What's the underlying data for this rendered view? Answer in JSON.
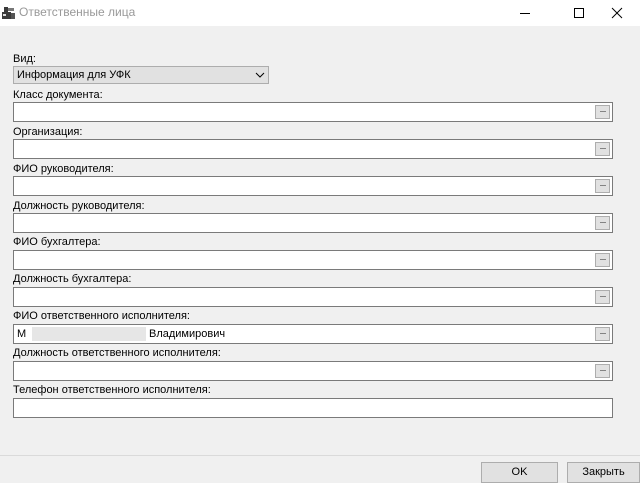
{
  "window": {
    "title": "Ответственные лица",
    "icon": "app-icon"
  },
  "fields": {
    "vid": {
      "label": "Вид:",
      "value": "Информация для УФК"
    },
    "klass_dokumenta": {
      "label": "Класс документа:",
      "value": ""
    },
    "organizaciya": {
      "label": "Организация:",
      "value": ""
    },
    "fio_rukovoditelya": {
      "label": "ФИО руководителя:",
      "value": ""
    },
    "dolzhnost_rukovoditelya": {
      "label": "Должность руководителя:",
      "value": ""
    },
    "fio_buhgaltera": {
      "label": "ФИО бухгалтера:",
      "value": ""
    },
    "dolzhnost_buhgaltera": {
      "label": "Должность бухгалтера:",
      "value": ""
    },
    "fio_ispolnitelya": {
      "label": "ФИО ответственного исполнителя:",
      "value_prefix": "М",
      "value_suffix": "Владимирович"
    },
    "dolzhnost_ispolnitelya": {
      "label": "Должность ответственного исполнителя:",
      "value": ""
    },
    "telefon_ispolnitelya": {
      "label": "Телефон ответственного исполнителя:",
      "value": ""
    }
  },
  "ellipsis_label": "···",
  "buttons": {
    "ok": "OK",
    "close": "Закрыть"
  }
}
